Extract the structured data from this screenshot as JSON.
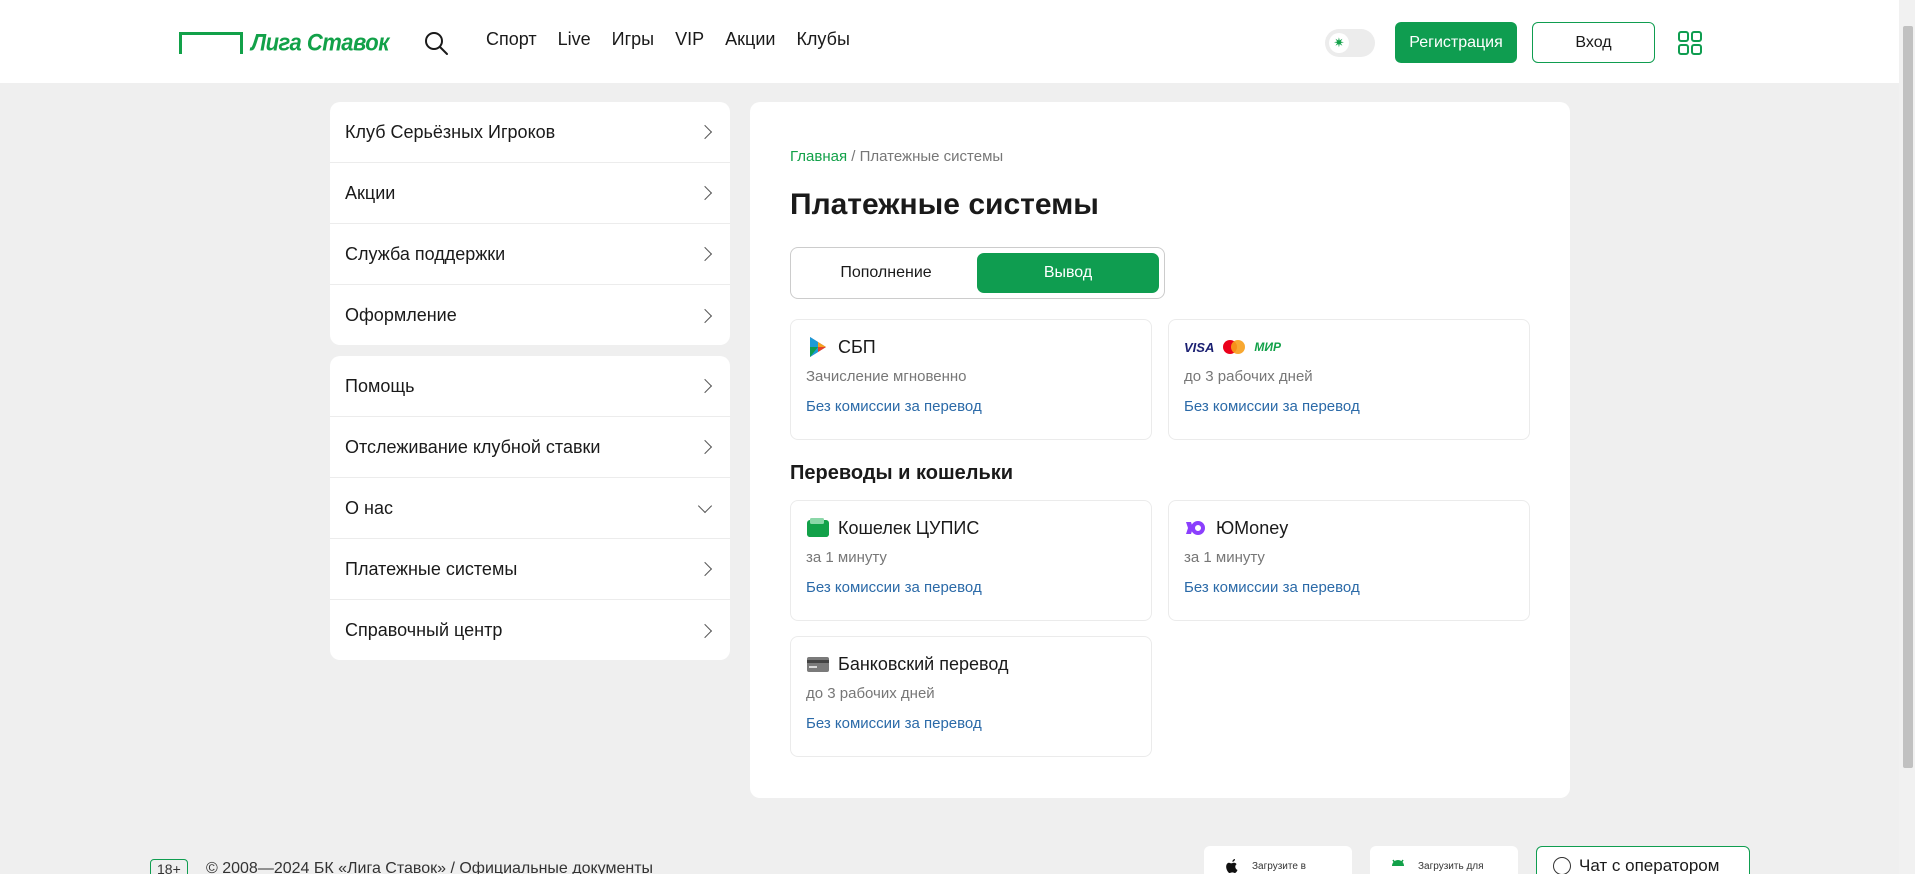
{
  "header": {
    "logo_text": "Лига Ставок",
    "nav": [
      "Спорт",
      "Live",
      "Игры",
      "VIP",
      "Акции",
      "Клубы"
    ],
    "register_label": "Регистрация",
    "login_label": "Вход"
  },
  "sidebar": {
    "group1": [
      {
        "label": "Клуб Серьёзных Игроков"
      },
      {
        "label": "Акции"
      },
      {
        "label": "Служба поддержки"
      },
      {
        "label": "Оформление"
      }
    ],
    "group2": [
      {
        "label": "Помощь"
      },
      {
        "label": "Отслеживание клубной ставки"
      },
      {
        "label": "О нас"
      },
      {
        "label": "Платежные системы"
      },
      {
        "label": "Справочный центр"
      }
    ]
  },
  "main": {
    "breadcrumb": {
      "home": "Главная",
      "separator": "/",
      "current": "Платежные системы"
    },
    "title": "Платежные системы",
    "tabs": [
      {
        "label": "Пополнение",
        "active": false
      },
      {
        "label": "Вывод",
        "active": true
      }
    ],
    "cards_top": [
      {
        "icon": "sbp-icon",
        "name": "СБП",
        "sub": "Зачисление мгновенно",
        "fee": "Без комиссии за перевод"
      },
      {
        "icon": "cards-icon",
        "name": "",
        "logos": {
          "visa": "VISA",
          "mir": "МИР"
        },
        "sub": "до 3 рабочих дней",
        "fee": "Без комиссии за перевод"
      }
    ],
    "section_title": "Переводы и кошельки",
    "cards_wallets": [
      {
        "icon": "wallet-icon",
        "name": "Кошелек ЦУПИС",
        "sub": "за 1 минуту",
        "fee": "Без комиссии за перевод"
      },
      {
        "icon": "yoomoney-icon",
        "name": "ЮMoney",
        "sub": "за 1 минуту",
        "fee": "Без комиссии за перевод"
      },
      {
        "icon": "bank-card-icon",
        "name": "Банковский перевод",
        "sub": "до 3 рабочих дней",
        "fee": "Без комиссии за перевод"
      }
    ]
  },
  "footer": {
    "age": "18+",
    "copyright": "© 2008—2024 БК «Лига Ставок» / Официальные документы",
    "store_apple": "Загрузите в",
    "store_android": "Загрузить для",
    "chat_label": "Чат с оператором"
  },
  "colors": {
    "brand": "#0f9d50",
    "link": "#2b6aa8",
    "background": "#efefef"
  }
}
